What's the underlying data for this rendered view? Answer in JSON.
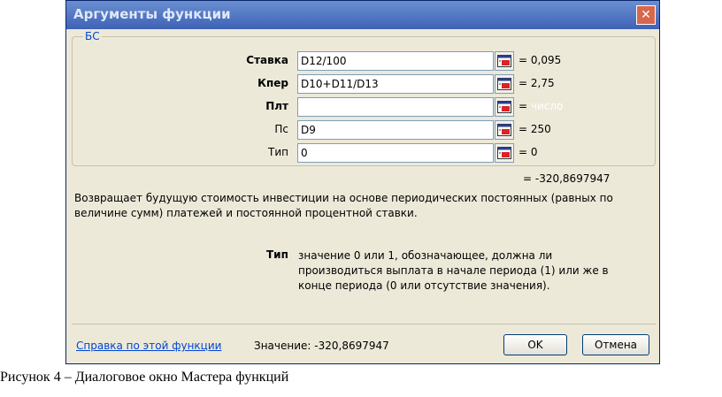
{
  "dialog": {
    "title": "Аргументы функции",
    "close_glyph": "✕"
  },
  "function_group": {
    "name": "БС",
    "args": [
      {
        "label": "Ставка",
        "bold": true,
        "value": "D12/100",
        "result": "= 0,095",
        "hint": ""
      },
      {
        "label": "Кпер",
        "bold": true,
        "value": "D10+D11/D13",
        "result": "= 2,75",
        "hint": ""
      },
      {
        "label": "Плт",
        "bold": true,
        "value": "",
        "result": "=",
        "hint": "число"
      },
      {
        "label": "Пс",
        "bold": false,
        "value": "D9",
        "result": "= 250",
        "hint": ""
      },
      {
        "label": "Тип",
        "bold": false,
        "value": "0",
        "result": "= 0",
        "hint": ""
      }
    ]
  },
  "total_result": "= -320,8697947",
  "description": "Возвращает будущую стоимость инвестиции на основе периодических постоянных (равных по величине сумм) платежей и постоянной процентной ставки.",
  "argument_help": {
    "name": "Тип",
    "text": "значение 0 или 1, обозначающее, должна ли производиться выплата в начале периода (1) или же в конце периода (0 или отсутствие значения)."
  },
  "footer": {
    "help_link": "Справка по этой функции",
    "value_label": "Значение:",
    "value": "-320,8697947",
    "ok_label": "OK",
    "cancel_label": "Отмена"
  },
  "caption": "Рисунок 4 – Диалоговое окно Мастера функций",
  "icons": {
    "ref_button": "collapse-dialog-icon"
  }
}
